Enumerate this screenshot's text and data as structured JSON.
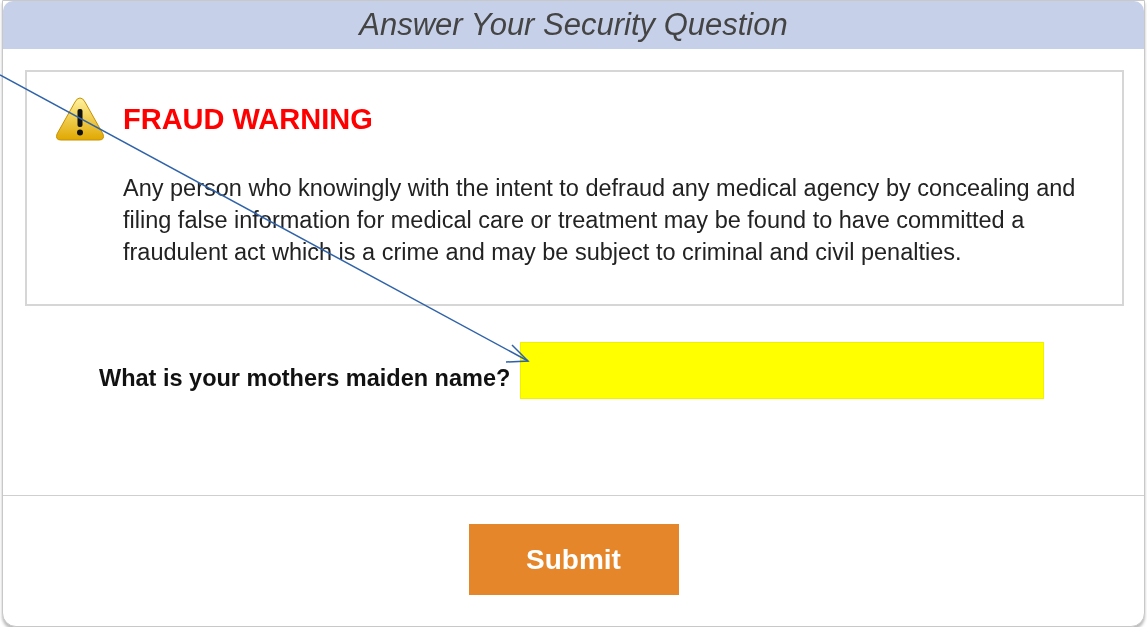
{
  "dialog": {
    "title": "Answer Your Security Question"
  },
  "warning": {
    "heading": "FRAUD WARNING",
    "text": "Any person who knowingly with the intent to defraud any medical agency by concealing and filing false information for medical care or treatment may be found to have committed a fraudulent act which is a crime and may be subject to criminal and civil penalties."
  },
  "question": {
    "label": "What is your mothers maiden name?",
    "highlighted": true
  },
  "buttons": [
    {
      "label": "Submit"
    }
  ]
}
